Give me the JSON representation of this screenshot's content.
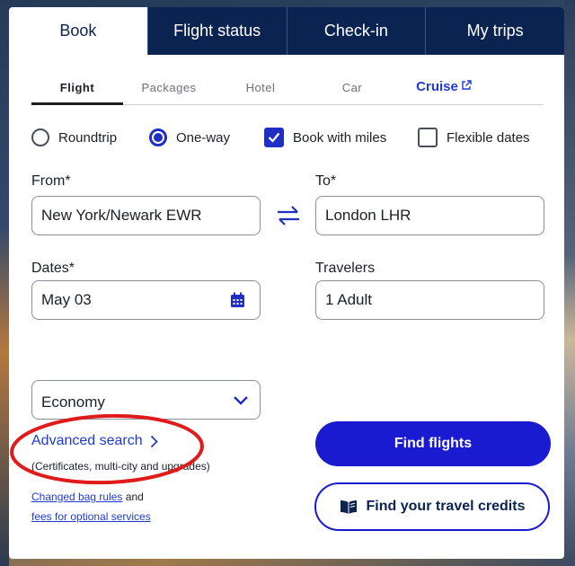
{
  "top_tabs": [
    {
      "label": "Book",
      "active": true
    },
    {
      "label": "Flight status",
      "active": false
    },
    {
      "label": "Check-in",
      "active": false
    },
    {
      "label": "My trips",
      "active": false
    }
  ],
  "sub_tabs": [
    {
      "label": "Flight",
      "active": true
    },
    {
      "label": "Packages",
      "active": false
    },
    {
      "label": "Hotel",
      "active": false
    },
    {
      "label": "Car",
      "active": false
    },
    {
      "label": "Cruise",
      "active": false,
      "external": true
    }
  ],
  "trip_options": {
    "roundtrip": {
      "label": "Roundtrip",
      "selected": false
    },
    "oneway": {
      "label": "One-way",
      "selected": true
    },
    "book_with_miles": {
      "label": "Book with miles",
      "checked": true
    },
    "flexible_dates": {
      "label": "Flexible dates",
      "checked": false
    }
  },
  "from": {
    "label": "From*",
    "value": "New York/Newark EWR"
  },
  "to": {
    "label": "To*",
    "value": "London LHR"
  },
  "dates": {
    "label": "Dates*",
    "value": "May 03"
  },
  "travelers": {
    "label": "Travelers",
    "value": "1 Adult"
  },
  "cabin": {
    "value": "Economy"
  },
  "advanced_search": {
    "label": "Advanced search",
    "subtitle": "(Certificates, multi-city and upgrades)"
  },
  "info": {
    "link1": "Changed bag rules",
    "and": "and",
    "link2": "fees for optional services"
  },
  "buttons": {
    "find_flights": "Find flights",
    "travel_credits": "Find your travel credits"
  },
  "colors": {
    "navy": "#0b2350",
    "accent": "#1a1bd0",
    "annotation": "#e01b1b"
  },
  "icons": [
    "external-link-icon",
    "swap-icon",
    "calendar-icon",
    "chevron-down-icon",
    "chevron-right-icon",
    "book-icon",
    "checkmark-icon"
  ]
}
